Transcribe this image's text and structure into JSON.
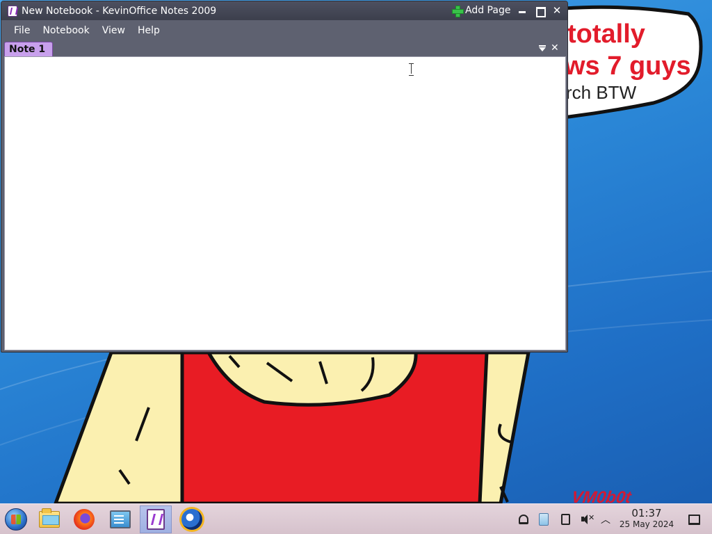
{
  "window": {
    "title": "New Notebook - KevinOffice Notes 2009",
    "add_page_label": "Add Page"
  },
  "menu": {
    "items": [
      "File",
      "Notebook",
      "View",
      "Help"
    ]
  },
  "tabs": [
    {
      "label": "Note 1",
      "active": true
    }
  ],
  "editor": {
    "content": ""
  },
  "wallpaper": {
    "bubble_lines": [
      "totally",
      "ws 7 guys",
      "rch BTW"
    ],
    "signature": "VM0b0t"
  },
  "taskbar": {
    "apps": [
      "start-orb-icon",
      "file-explorer-icon",
      "firefox-icon",
      "system-monitor-icon",
      "kevinoffice-notes-icon",
      "globe-icon"
    ],
    "active_app": "kevinoffice-notes-icon",
    "tray_icons": [
      "bell-icon",
      "clipboard-app-icon",
      "clipboard-icon",
      "volume-muted-icon",
      "chevron-up-icon",
      "show-desktop-icon"
    ],
    "clock_time": "01:37",
    "clock_date": "25 May 2024"
  },
  "colors": {
    "titlebar": "#444755",
    "tab_active": "#c8a0ec",
    "taskbar": "#dccad2",
    "taskbar_active": "#a9b8e8",
    "desktop": "#2c8ad9"
  }
}
